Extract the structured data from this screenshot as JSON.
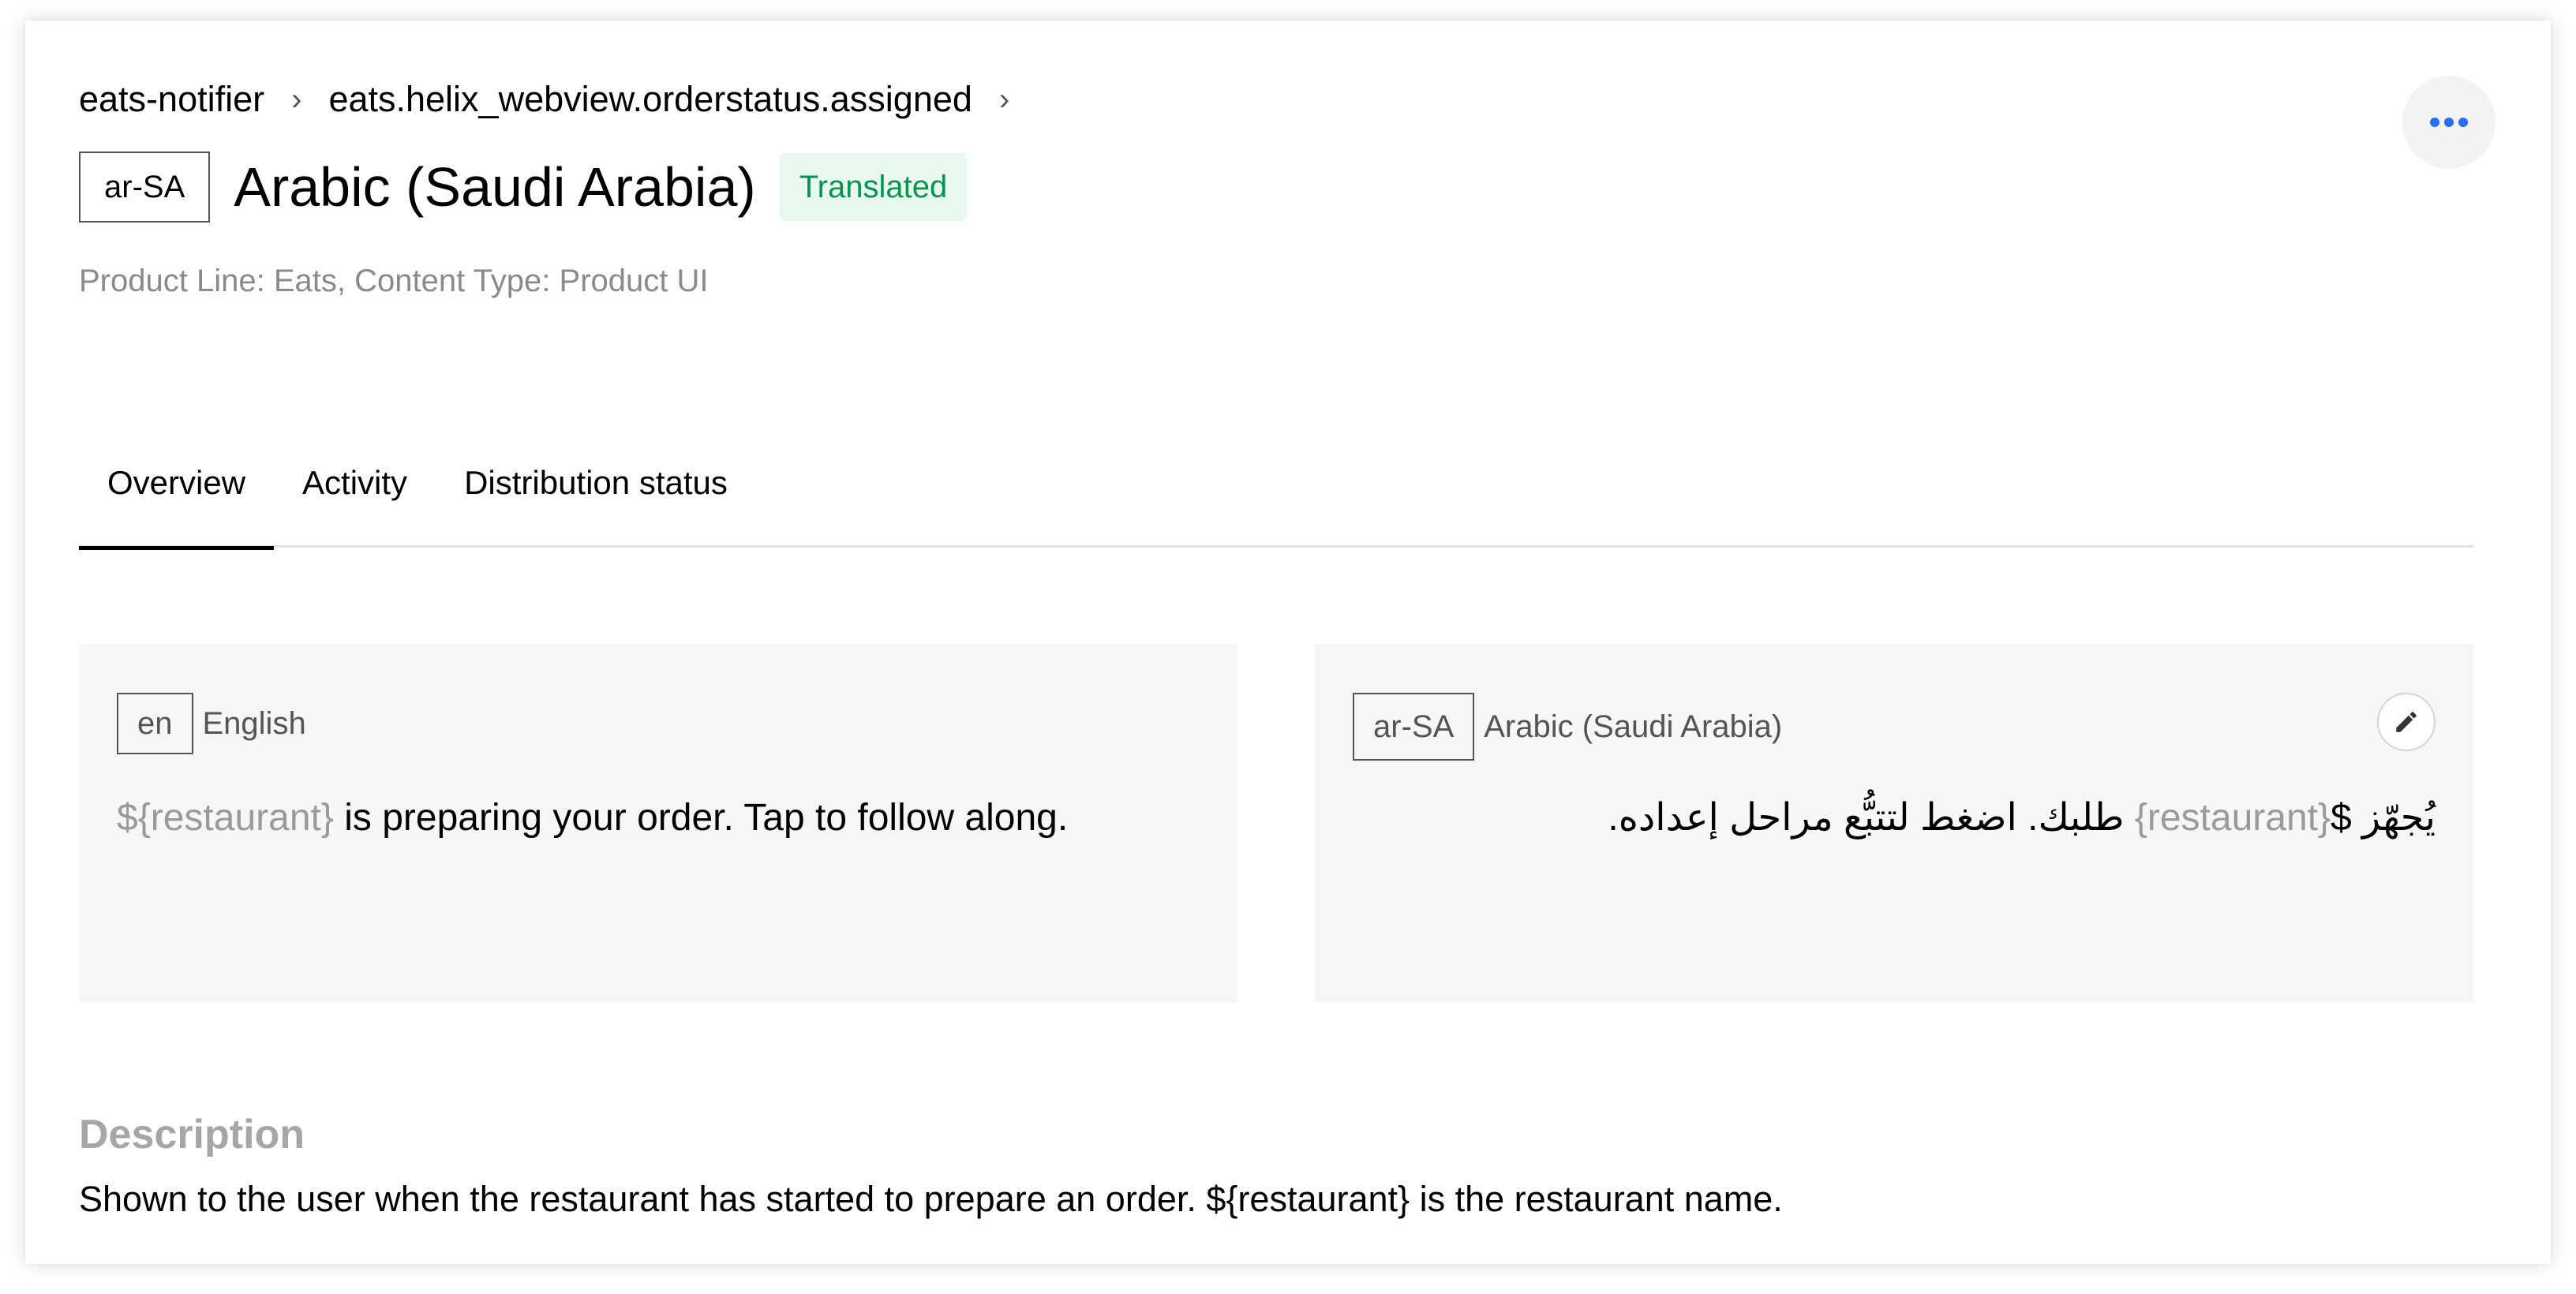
{
  "breadcrumb": {
    "items": [
      "eats-notifier",
      "eats.helix_webview.orderstatus.assigned"
    ],
    "separator": "›"
  },
  "header": {
    "locale_code": "ar-SA",
    "title": "Arabic (Saudi Arabia)",
    "status": "Translated",
    "meta": "Product Line: Eats, Content Type: Product UI",
    "more_icon": "ellipsis-icon"
  },
  "tabs": [
    {
      "label": "Overview",
      "active": true
    },
    {
      "label": "Activity",
      "active": false
    },
    {
      "label": "Distribution status",
      "active": false
    }
  ],
  "source_panel": {
    "code": "en",
    "language": "English",
    "placeholder": "${restaurant}",
    "text": " is preparing your order. Tap to follow along."
  },
  "target_panel": {
    "code": "ar-SA",
    "language": "Arabic (Saudi Arabia)",
    "text_before": "يُجهّز $",
    "placeholder": "{restaurant}",
    "text_after": " طلبك. اضغط لتتبُّع مراحل إعداده.",
    "edit_icon": "pencil-icon"
  },
  "description": {
    "title": "Description",
    "text": "Shown to the user when the restaurant has started to prepare an order. ${restaurant} is the restaurant name."
  },
  "colors": {
    "accent": "#276ef1",
    "success_text": "#05944f",
    "success_bg": "#e8f8ee",
    "muted": "#8a8a8a"
  }
}
